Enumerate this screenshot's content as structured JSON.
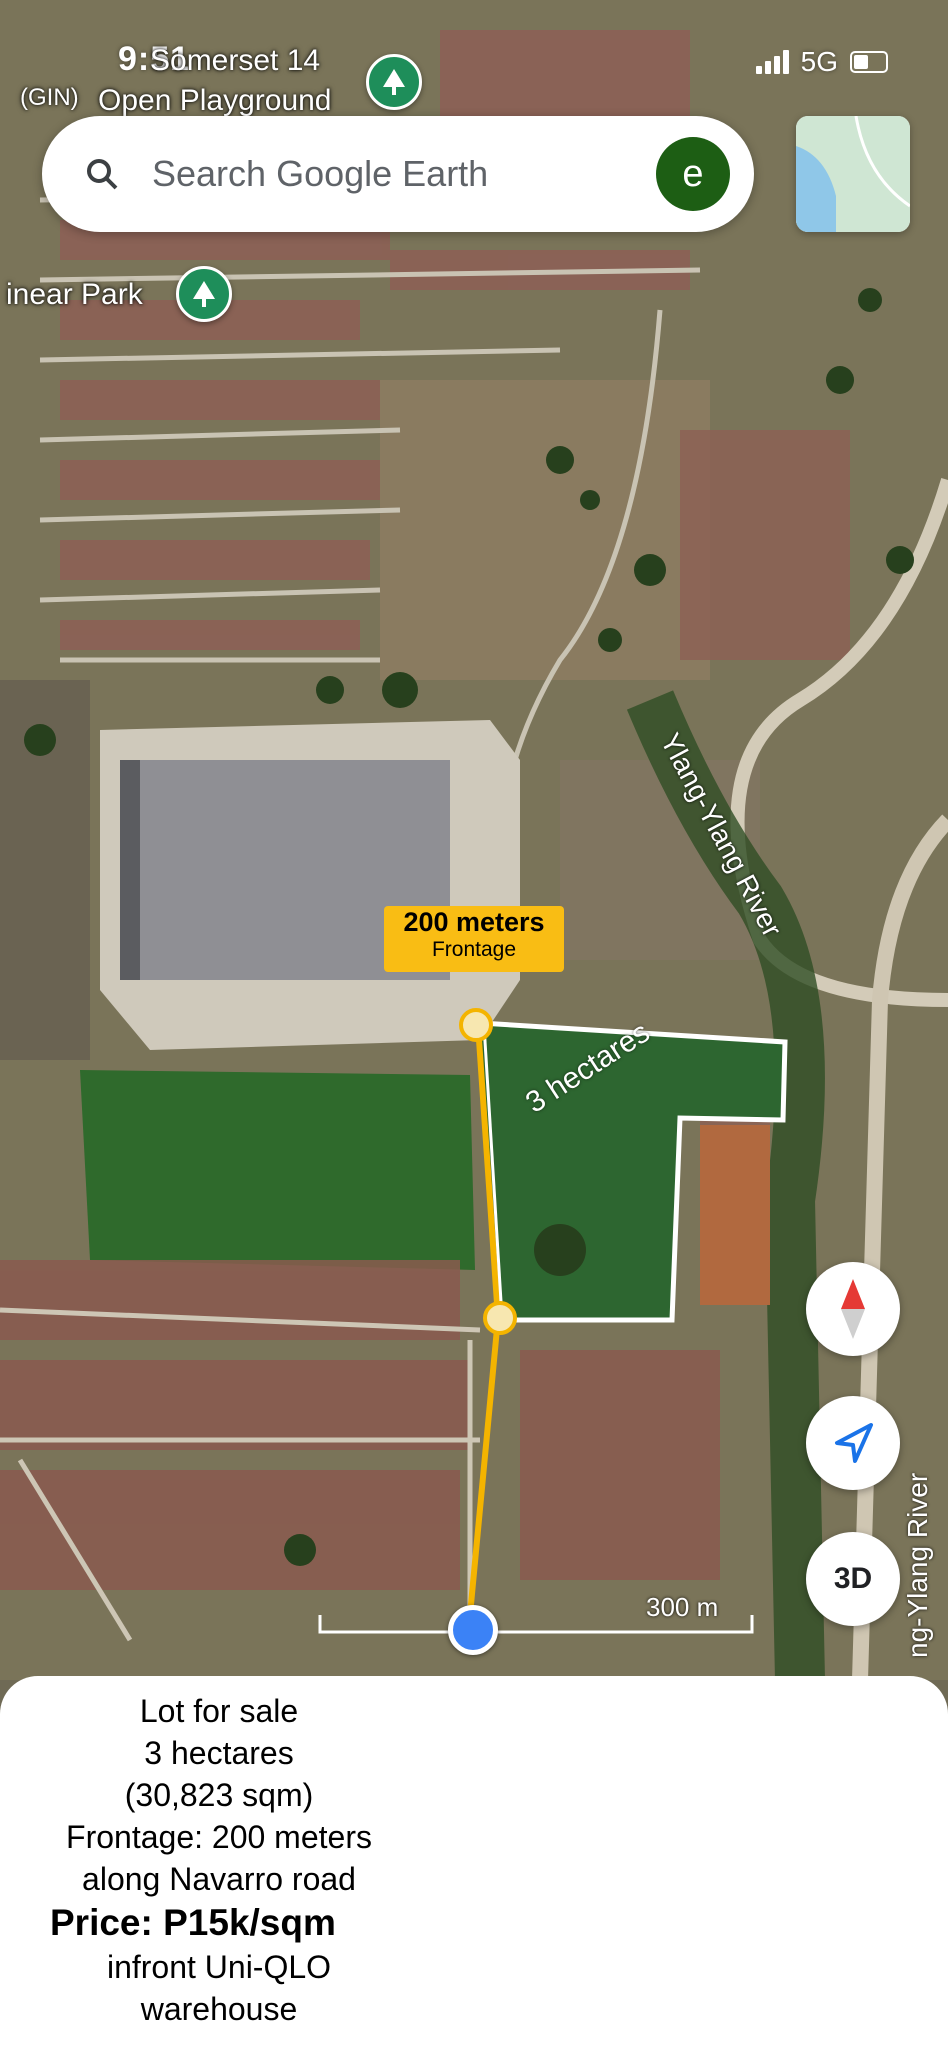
{
  "status_bar": {
    "time": "9:51",
    "network": "5G"
  },
  "map_labels": {
    "somerset": "Somerset 14",
    "playground_prefix": "(GIN)",
    "playground": "Open Playground",
    "linear_park": "inear Park",
    "river_upper": "Ylang-Ylang River",
    "river_lower": "ng-Ylang River"
  },
  "search": {
    "placeholder": "Search Google Earth",
    "avatar_letter": "e"
  },
  "annotation": {
    "frontage_title": "200 meters",
    "frontage_sub": "Frontage",
    "area": "3 hectares"
  },
  "controls": {
    "three_d": "3D"
  },
  "scale": {
    "label": "300 m"
  },
  "listing": {
    "line1": "Lot for sale",
    "line2": "3 hectares",
    "line3": "(30,823 sqm)",
    "line4": "Frontage: 200 meters",
    "line5": "along Navarro road",
    "price": "Price: P15k/sqm",
    "line7": "infront Uni-QLO",
    "line8": "warehouse"
  },
  "colors": {
    "pin_green": "#1e8e5a",
    "callout_yellow": "#f9bd14",
    "route_yellow": "#f4b400",
    "lot_outline": "#ffffff",
    "location_blue": "#3b82f6",
    "compass_red": "#e53935"
  },
  "icons": [
    "tree-pin-icon",
    "search-icon",
    "avatar-icon",
    "map-layers-icon",
    "compass-icon",
    "navigation-arrow-icon"
  ]
}
